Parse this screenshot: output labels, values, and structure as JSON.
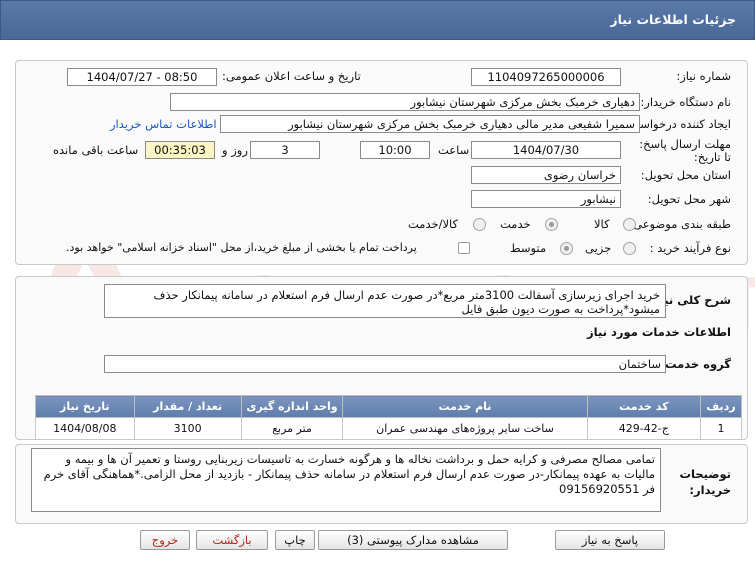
{
  "header": {
    "title": "جزئیات اطلاعات نیاز"
  },
  "labels": {
    "need_number": "شماره نیاز:",
    "announce_datetime": "تاریخ و ساعت اعلان عمومی:",
    "buyer_org": "نام دستگاه خریدار:",
    "requester": "ایجاد کننده درخواست:",
    "contact_link": "اطلاعات تماس خریدار",
    "deadline": "مهلت ارسال پاسخ: تا تاریخ:",
    "time": "ساعت",
    "days_and": "روز و",
    "remaining": "ساعت باقی مانده",
    "province": "استان محل تحویل:",
    "city": "شهر محل تحویل:",
    "category": "طبقه بندی موضوعی:",
    "process_type": "نوع فرآیند خرید :",
    "general_desc": "شرح کلی نیاز:",
    "services_info": "اطلاعات خدمات مورد نیاز",
    "service_group": "گروه خدمت:",
    "buyer_notes": "توضیحات خریدار:"
  },
  "fields": {
    "need_number": "1104097265000006",
    "announce_datetime": "1404/07/27 - 08:50",
    "buyer_org": "دهیاری خرمبک بخش مرکزی شهرستان نیشابور",
    "requester": "سمیرا شفیعی مدیر مالی دهیاری خرمبک بخش مرکزی شهرستان نیشابور",
    "deadline_date": "1404/07/30",
    "deadline_time": "10:00",
    "days": "3",
    "remaining_time": "00:35:03",
    "province": "خراسان رضوی",
    "city": "نیشابور",
    "service_group": "ساختمان"
  },
  "category_options": [
    "کالا",
    "خدمت",
    "کالا/خدمت"
  ],
  "category_selected": "خدمت",
  "process_options": [
    "جزیی",
    "متوسط"
  ],
  "process_selected": "متوسط",
  "payment_note": "پرداخت تمام یا بخشی از مبلغ خرید،از محل \"اسناد خزانه اسلامی\" خواهد بود.",
  "general_description": "خرید اجرای زیرسازی آسفالت 3100متر مربع*در صورت عدم ارسال فرم استعلام در سامانه پیمانکار حذف میشود*پرداخت به صورت دیون طبق فایل",
  "table": {
    "headers": [
      "ردیف",
      "کد خدمت",
      "نام خدمت",
      "واحد اندازه گیری",
      "تعداد / مقدار",
      "تاریخ نیاز"
    ],
    "rows": [
      [
        "1",
        "ج-42-429",
        "ساخت سایر پروژه‌های مهندسی عمران",
        "متر مربع",
        "3100",
        "1404/08/08"
      ]
    ]
  },
  "buyer_notes_text": "تمامی مصالح مصرفی و کرایه حمل و برداشت نخاله ها و هرگونه خسارت به تاسیسات زیربنایی روستا و تعمیر آن ها و بیمه و مالیات به عهده پیمانکار-در صورت عدم ارسال فرم استعلام در سامانه حذف پیمانکار - بازدید از محل الزامی.*هماهنگی آقای خرم فر 09156920551",
  "buttons": {
    "reply": "پاسخ به نیاز",
    "attachments": "مشاهده مدارک پیوستی (3)",
    "print": "چاپ",
    "back": "بازگشت",
    "exit": "خروج"
  },
  "watermark_text": "AriaTender.neT",
  "colors": {
    "header": "#5b79a9",
    "link": "#1a56c4",
    "highlight": "#fbf6c3",
    "watermark": "#c0392b"
  }
}
